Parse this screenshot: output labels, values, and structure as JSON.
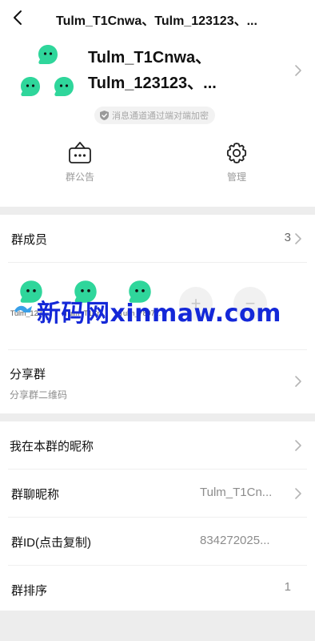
{
  "topbar": {
    "title": "Tulm_T1Cnwa、Tulm_123123、..."
  },
  "header": {
    "group_name_line1": "Tulm_T1Cnwa、",
    "group_name_line2": "Tulm_123123、...",
    "encryption_note": "消息通道通过端对端加密",
    "actions": [
      {
        "label": "群公告",
        "icon": "notice-board-icon"
      },
      {
        "label": "管理",
        "icon": "gear-icon"
      }
    ]
  },
  "members_section": {
    "label": "群成员",
    "count": "3",
    "members": [
      {
        "name": "Tulm_1231..."
      },
      {
        "name": "Tulm_T1Cn..."
      },
      {
        "name": "Tulm_7897..."
      }
    ],
    "add_symbol": "+",
    "remove_symbol": "−"
  },
  "share_section": {
    "label": "分享群",
    "sub": "分享群二维码"
  },
  "settings": {
    "my_nickname_label": "我在本群的昵称",
    "group_nickname_label": "群聊昵称",
    "group_nickname_value": "Tulm_T1Cn...",
    "group_id_label": "群ID(点击复制)",
    "group_id_value": "834272025...",
    "group_order_label": "群排序",
    "group_order_value": "1"
  },
  "watermark": {
    "text": "新码网xinmaw.com"
  },
  "colors": {
    "accent_green": "#2fd69b",
    "watermark_blue": "#1428d8",
    "background": "#ededed"
  }
}
